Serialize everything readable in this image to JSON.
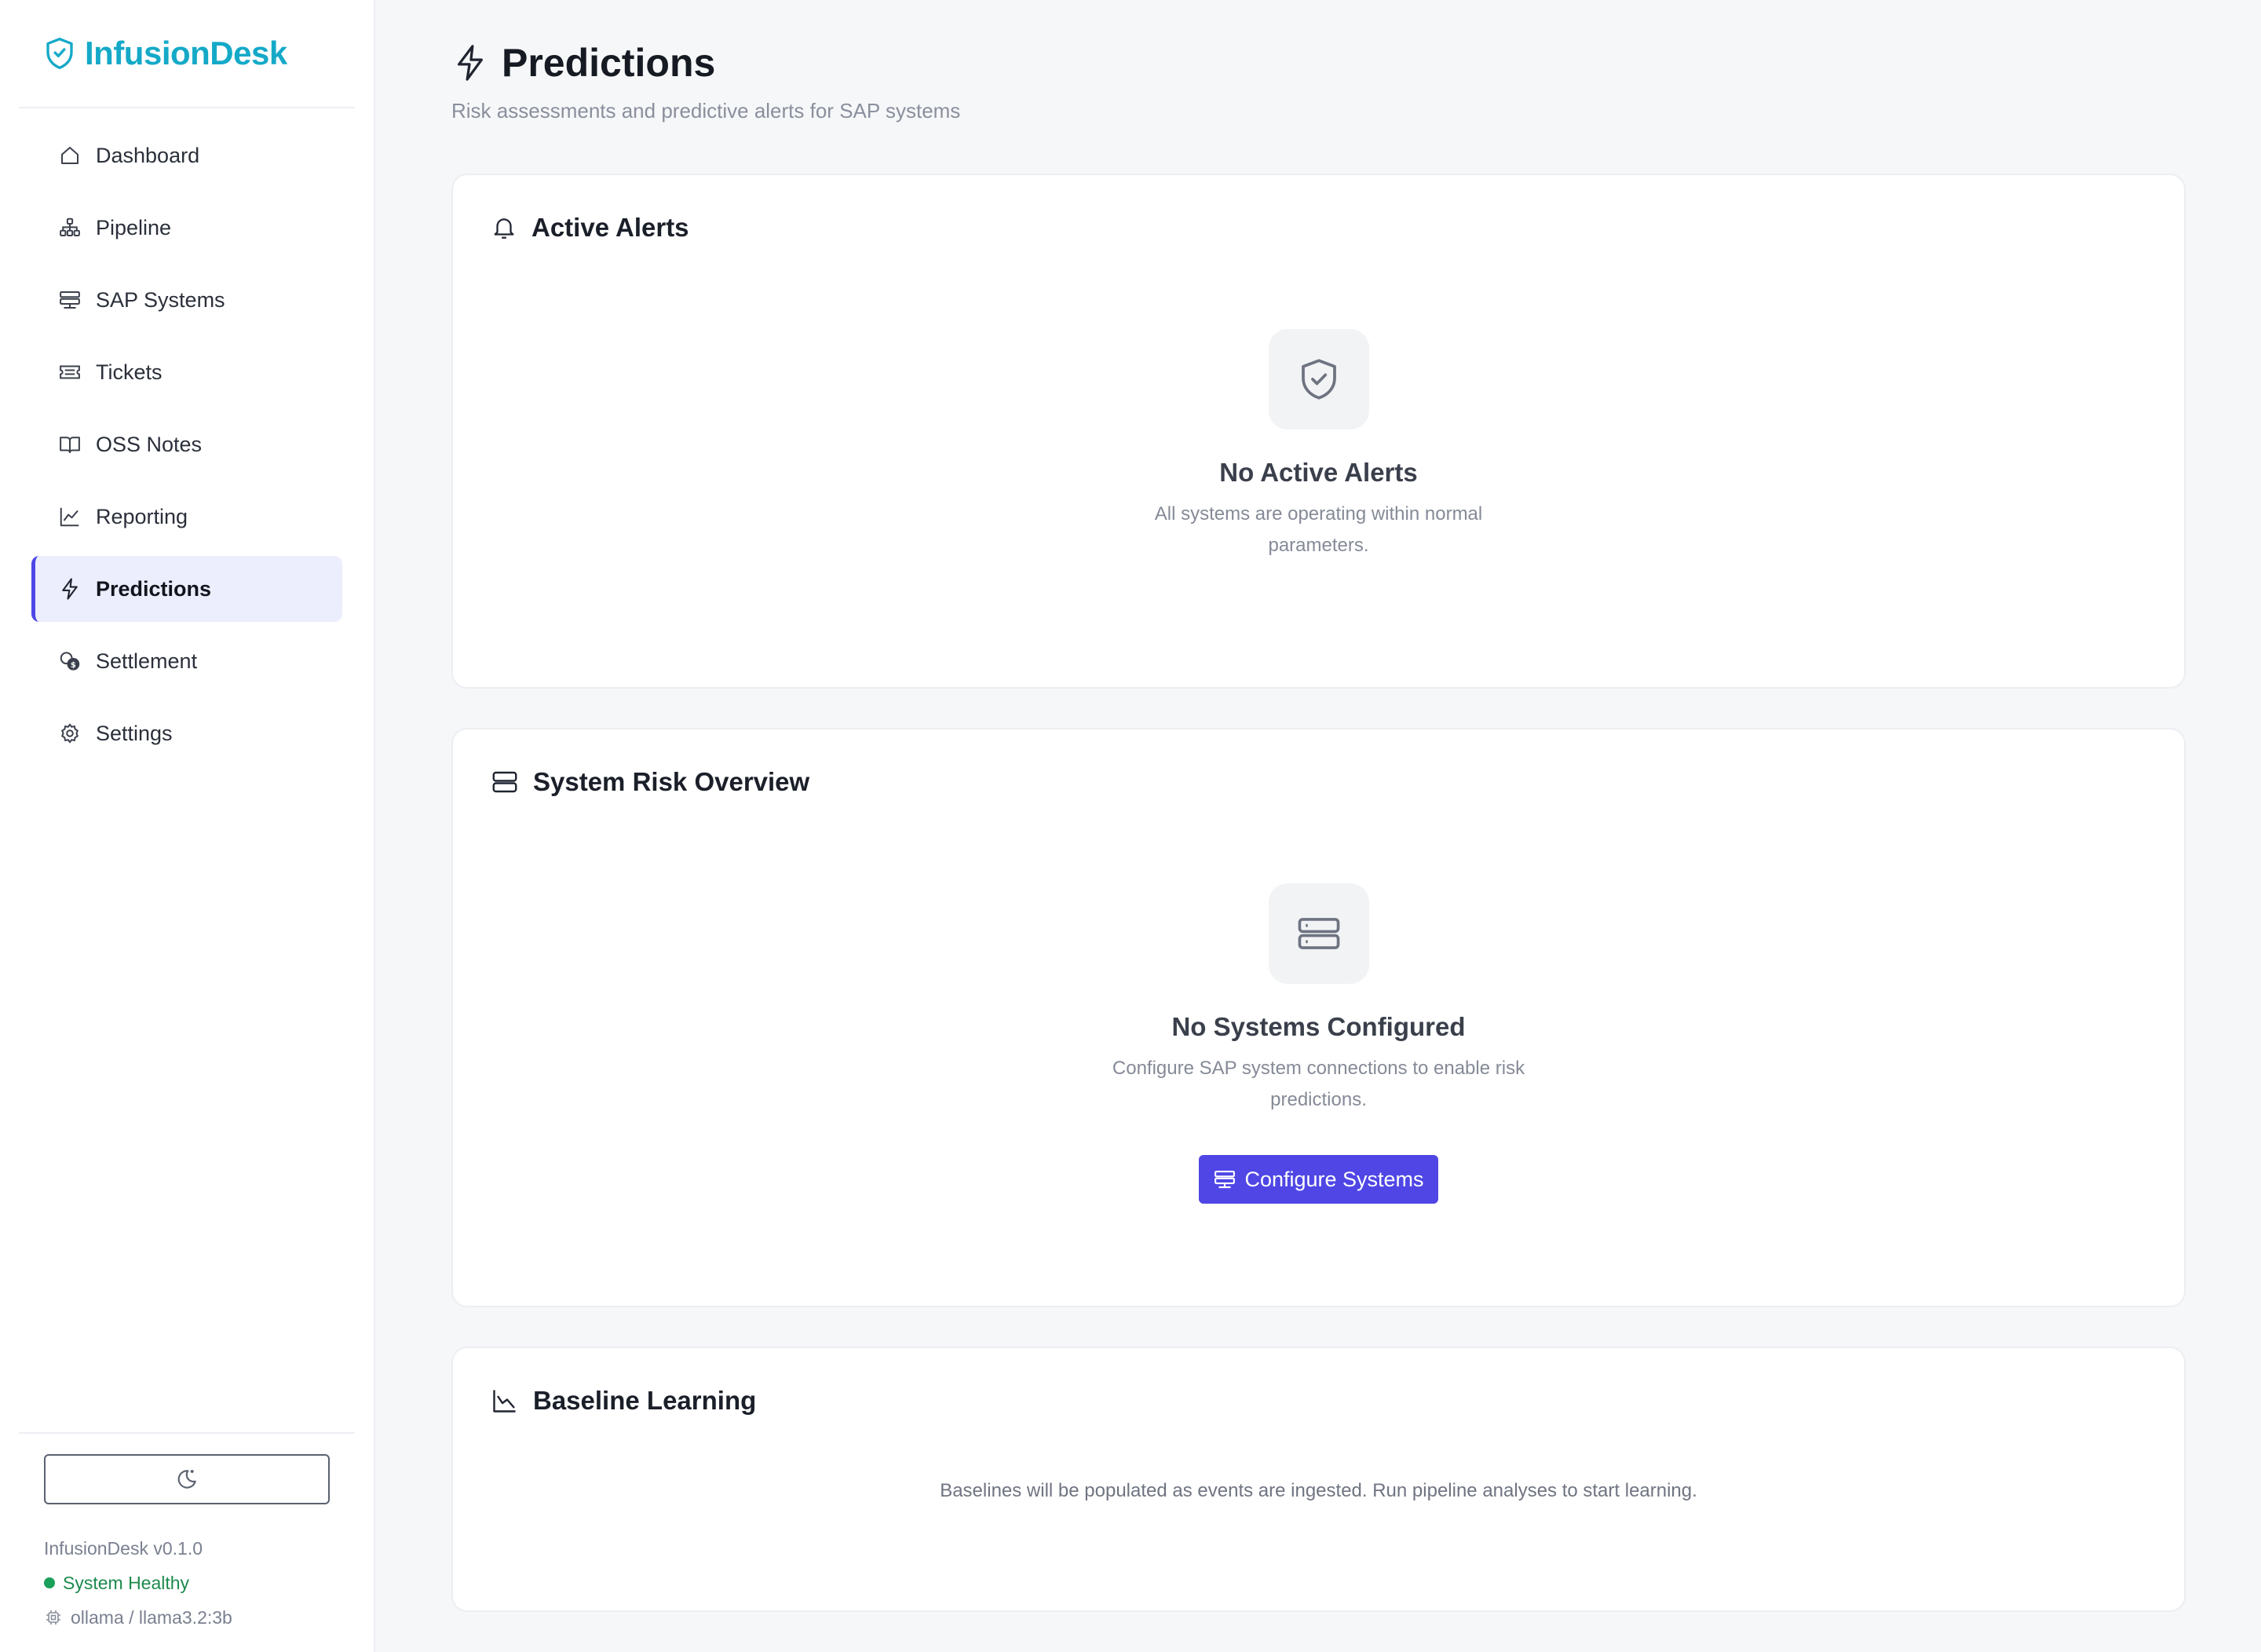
{
  "brand": {
    "name": "InfusionDesk",
    "accent": "#15a9c8"
  },
  "nav": [
    {
      "label": "Dashboard",
      "icon": "home-icon"
    },
    {
      "label": "Pipeline",
      "icon": "pipeline-icon"
    },
    {
      "label": "SAP Systems",
      "icon": "server-icon"
    },
    {
      "label": "Tickets",
      "icon": "ticket-icon"
    },
    {
      "label": "OSS Notes",
      "icon": "book-icon"
    },
    {
      "label": "Reporting",
      "icon": "chart-icon"
    },
    {
      "label": "Predictions",
      "icon": "lightning-icon",
      "active": true
    },
    {
      "label": "Settlement",
      "icon": "coins-icon"
    },
    {
      "label": "Settings",
      "icon": "gear-icon"
    }
  ],
  "footer": {
    "version": "InfusionDesk v0.1.0",
    "health": "System Healthy",
    "model": "ollama / llama3.2:3b"
  },
  "page": {
    "title": "Predictions",
    "subtitle": "Risk assessments and predictive alerts for SAP systems"
  },
  "alerts": {
    "title": "Active Alerts",
    "empty_title": "No Active Alerts",
    "empty_desc": "All systems are operating within normal parameters."
  },
  "risk": {
    "title": "System Risk Overview",
    "empty_title": "No Systems Configured",
    "empty_desc": "Configure SAP system connections to enable risk predictions.",
    "button_label": "Configure Systems"
  },
  "baseline": {
    "title": "Baseline Learning",
    "text": "Baselines will be populated as events are ingested. Run pipeline analyses to start learning."
  },
  "colors": {
    "primary": "#4f46e5",
    "healthy": "#1aa05a"
  }
}
